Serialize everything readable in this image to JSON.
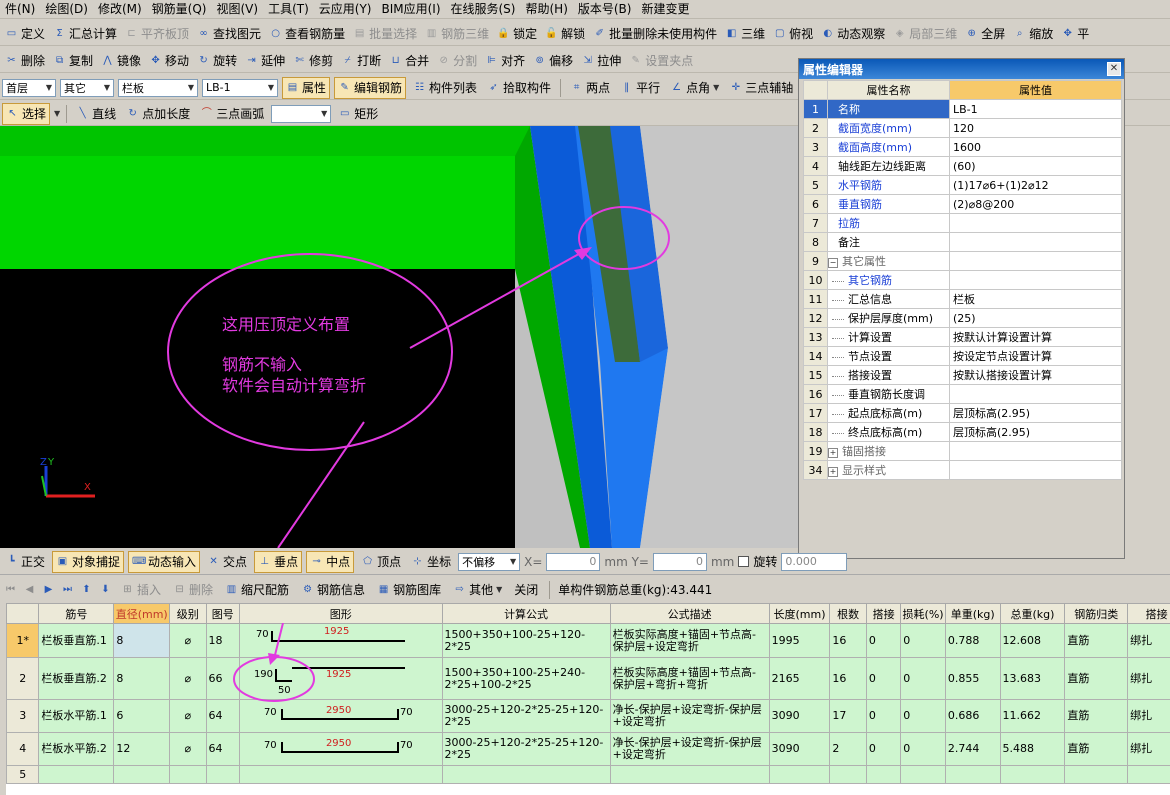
{
  "menu": [
    "件(N)",
    "绘图(D)",
    "修改(M)",
    "钢筋量(Q)",
    "视图(V)",
    "工具(T)",
    "云应用(Y)",
    "BIM应用(I)",
    "在线服务(S)",
    "帮助(H)",
    "版本号(B)",
    "新建变更"
  ],
  "toolbar1": [
    {
      "icon": "ruler-icon",
      "label": "定义",
      "on": true
    },
    {
      "icon": "sigma-icon",
      "label": "汇总计算",
      "on": true
    },
    {
      "icon": "flat-plate-icon",
      "label": "平齐板顶",
      "on": false
    },
    {
      "icon": "binoculars-icon",
      "label": "查找图元",
      "on": true
    },
    {
      "icon": "glasses-icon",
      "label": "查看钢筋量",
      "on": true
    },
    {
      "icon": "batch-select-icon",
      "label": "批量选择",
      "on": false
    },
    {
      "icon": "rebar-3d-icon",
      "label": "钢筋三维",
      "on": false
    },
    {
      "icon": "lock-icon",
      "label": "锁定",
      "on": true
    },
    {
      "icon": "unlock-icon",
      "label": "解锁",
      "on": true
    },
    {
      "icon": "batch-delete-icon",
      "label": "批量删除未使用构件",
      "on": true
    },
    {
      "icon": "cube-icon",
      "label": "三维",
      "on": true
    },
    {
      "icon": "view-icon",
      "label": "俯视",
      "on": true
    },
    {
      "icon": "orbit-icon",
      "label": "动态观察",
      "on": true
    },
    {
      "icon": "local-3d-icon",
      "label": "局部三维",
      "on": false
    },
    {
      "icon": "fullscreen-icon",
      "label": "全屏",
      "on": true
    },
    {
      "icon": "zoom-icon",
      "label": "缩放",
      "on": true
    },
    {
      "icon": "pan-icon",
      "label": "平",
      "on": true
    }
  ],
  "toolbar2": [
    {
      "icon": "delete-icon",
      "label": "删除",
      "on": true
    },
    {
      "icon": "copy-icon",
      "label": "复制",
      "on": true
    },
    {
      "icon": "mirror-icon",
      "label": "镜像",
      "on": true
    },
    {
      "icon": "move-icon",
      "label": "移动",
      "on": true
    },
    {
      "icon": "rotate-icon",
      "label": "旋转",
      "on": true
    },
    {
      "icon": "extend-icon",
      "label": "延伸",
      "on": true
    },
    {
      "icon": "trim-icon",
      "label": "修剪",
      "on": true
    },
    {
      "icon": "break-icon",
      "label": "打断",
      "on": true
    },
    {
      "icon": "merge-icon",
      "label": "合并",
      "on": true
    },
    {
      "icon": "split-icon",
      "label": "分割",
      "on": false
    },
    {
      "icon": "align-icon",
      "label": "对齐",
      "on": true
    },
    {
      "icon": "offset-icon",
      "label": "偏移",
      "on": true
    },
    {
      "icon": "stretch-icon",
      "label": "拉伸",
      "on": true
    },
    {
      "icon": "set-clamp-icon",
      "label": "设置夹点",
      "on": false
    }
  ],
  "toolbar3": {
    "floor": "首层",
    "category": "其它",
    "type": "栏板",
    "member": "LB-1",
    "buttons": [
      "属性",
      "编辑钢筋",
      "构件列表",
      "拾取构件",
      "两点",
      "平行",
      "点角",
      "三点辅轴"
    ]
  },
  "toolbar4": {
    "select": "选择",
    "buttons": [
      "直线",
      "点加长度",
      "三点画弧",
      "矩形"
    ]
  },
  "viewport": {
    "annotation_line1": "这用压顶定义布置",
    "annotation_line2": "钢筋不输入",
    "annotation_line3": "软件会自动计算弯折",
    "axis_z": "Z",
    "axis_x": "X",
    "axis_y": "Y"
  },
  "colors": {
    "slab_green": "#00d000",
    "wall_blue": "#1c6fe0",
    "annotation": "#e23ae0",
    "header_orange": "#f7c96a"
  },
  "property_editor": {
    "title": "属性编辑器",
    "col_name": "属性名称",
    "col_value": "属性值",
    "rows": [
      {
        "no": "1",
        "name": "名称",
        "value": "LB-1",
        "style": "blue"
      },
      {
        "no": "2",
        "name": "截面宽度(mm)",
        "value": "120",
        "style": "blue"
      },
      {
        "no": "3",
        "name": "截面高度(mm)",
        "value": "1600",
        "style": "blue"
      },
      {
        "no": "4",
        "name": "轴线距左边线距离",
        "value": "(60)",
        "style": ""
      },
      {
        "no": "5",
        "name": "水平钢筋",
        "value": "(1)17⌀6+(1)2⌀12",
        "style": "blue"
      },
      {
        "no": "6",
        "name": "垂直钢筋",
        "value": "(2)⌀8@200",
        "style": "blue"
      },
      {
        "no": "7",
        "name": "拉筋",
        "value": "",
        "style": "blue"
      },
      {
        "no": "8",
        "name": "备注",
        "value": "",
        "style": ""
      },
      {
        "no": "9",
        "name": "其它属性",
        "value": "",
        "style": "group"
      },
      {
        "no": "10",
        "name": "其它钢筋",
        "value": "",
        "style": "blue-sub"
      },
      {
        "no": "11",
        "name": "汇总信息",
        "value": "栏板",
        "style": "sub"
      },
      {
        "no": "12",
        "name": "保护层厚度(mm)",
        "value": "(25)",
        "style": "sub"
      },
      {
        "no": "13",
        "name": "计算设置",
        "value": "按默认计算设置计算",
        "style": "sub"
      },
      {
        "no": "14",
        "name": "节点设置",
        "value": "按设定节点设置计算",
        "style": "sub"
      },
      {
        "no": "15",
        "name": "搭接设置",
        "value": "按默认搭接设置计算",
        "style": "sub"
      },
      {
        "no": "16",
        "name": "垂直钢筋长度调",
        "value": "",
        "style": "sub"
      },
      {
        "no": "17",
        "name": "起点底标高(m)",
        "value": "层顶标高(2.95)",
        "style": "sub"
      },
      {
        "no": "18",
        "name": "终点底标高(m)",
        "value": "层顶标高(2.95)",
        "style": "sub"
      },
      {
        "no": "19",
        "name": "锚固搭接",
        "value": "",
        "style": "group"
      },
      {
        "no": "34",
        "name": "显示样式",
        "value": "",
        "style": "group"
      }
    ]
  },
  "statusbar": {
    "items": [
      "正交",
      "对象捕捉",
      "动态输入",
      "交点",
      "垂点",
      "中点",
      "顶点",
      "坐标",
      "不偏移"
    ],
    "x_label": "X=",
    "x_value": "0",
    "y_label": "mm Y=",
    "y_value": "0",
    "unit": "mm",
    "rotate": "旋转",
    "rotate_value": "0.000"
  },
  "rebar_toolbar": {
    "items": [
      "插入",
      "删除",
      "缩尺配筋",
      "钢筋信息",
      "钢筋图库",
      "其他",
      "关闭"
    ],
    "total_label": "单构件钢筋总重(kg):43.441"
  },
  "grid": {
    "headers": [
      "筋号",
      "直径(mm)",
      "级别",
      "图号",
      "图形",
      "计算公式",
      "公式描述",
      "长度(mm)",
      "根数",
      "搭接",
      "损耗(%)",
      "单重(kg)",
      "总重(kg)",
      "钢筋归类",
      "搭接"
    ],
    "rows": [
      {
        "num": "1*",
        "name": "栏板垂直筋.1",
        "dia": "8",
        "grade": "⌀",
        "fig": "18",
        "shape_a": "70",
        "shape_b": "1925",
        "shape_c": "",
        "formula": "1500+350+100-25+120-2*25",
        "desc": "栏板实际高度+锚固+节点高-保护层+设定弯折",
        "len": "1995",
        "count": "16",
        "lap": "0",
        "loss": "0",
        "unit": "0.788",
        "total": "12.608",
        "cls": "直筋",
        "lapt": "绑扎"
      },
      {
        "num": "2",
        "name": "栏板垂直筋.2",
        "dia": "8",
        "grade": "⌀",
        "fig": "66",
        "shape_a": "190",
        "shape_b": "1925",
        "shape_c": "50",
        "formula": "1500+350+100-25+240-2*25+100-2*25",
        "desc": "栏板实际高度+锚固+节点高-保护层+弯折+弯折",
        "len": "2165",
        "count": "16",
        "lap": "0",
        "loss": "0",
        "unit": "0.855",
        "total": "13.683",
        "cls": "直筋",
        "lapt": "绑扎"
      },
      {
        "num": "3",
        "name": "栏板水平筋.1",
        "dia": "6",
        "grade": "⌀",
        "fig": "64",
        "shape_a": "70",
        "shape_b": "2950",
        "shape_c": "70",
        "formula": "3000-25+120-2*25-25+120-2*25",
        "desc": "净长-保护层+设定弯折-保护层+设定弯折",
        "len": "3090",
        "count": "17",
        "lap": "0",
        "loss": "0",
        "unit": "0.686",
        "total": "11.662",
        "cls": "直筋",
        "lapt": "绑扎"
      },
      {
        "num": "4",
        "name": "栏板水平筋.2",
        "dia": "12",
        "grade": "⌀",
        "fig": "64",
        "shape_a": "70",
        "shape_b": "2950",
        "shape_c": "70",
        "formula": "3000-25+120-2*25-25+120-2*25",
        "desc": "净长-保护层+设定弯折-保护层+设定弯折",
        "len": "3090",
        "count": "2",
        "lap": "0",
        "loss": "0",
        "unit": "2.744",
        "total": "5.488",
        "cls": "直筋",
        "lapt": "绑扎"
      },
      {
        "num": "5",
        "name": "",
        "dia": "",
        "grade": "",
        "fig": "",
        "shape_a": "",
        "shape_b": "",
        "shape_c": "",
        "formula": "",
        "desc": "",
        "len": "",
        "count": "",
        "lap": "",
        "loss": "",
        "unit": "",
        "total": "",
        "cls": "",
        "lapt": ""
      }
    ]
  }
}
